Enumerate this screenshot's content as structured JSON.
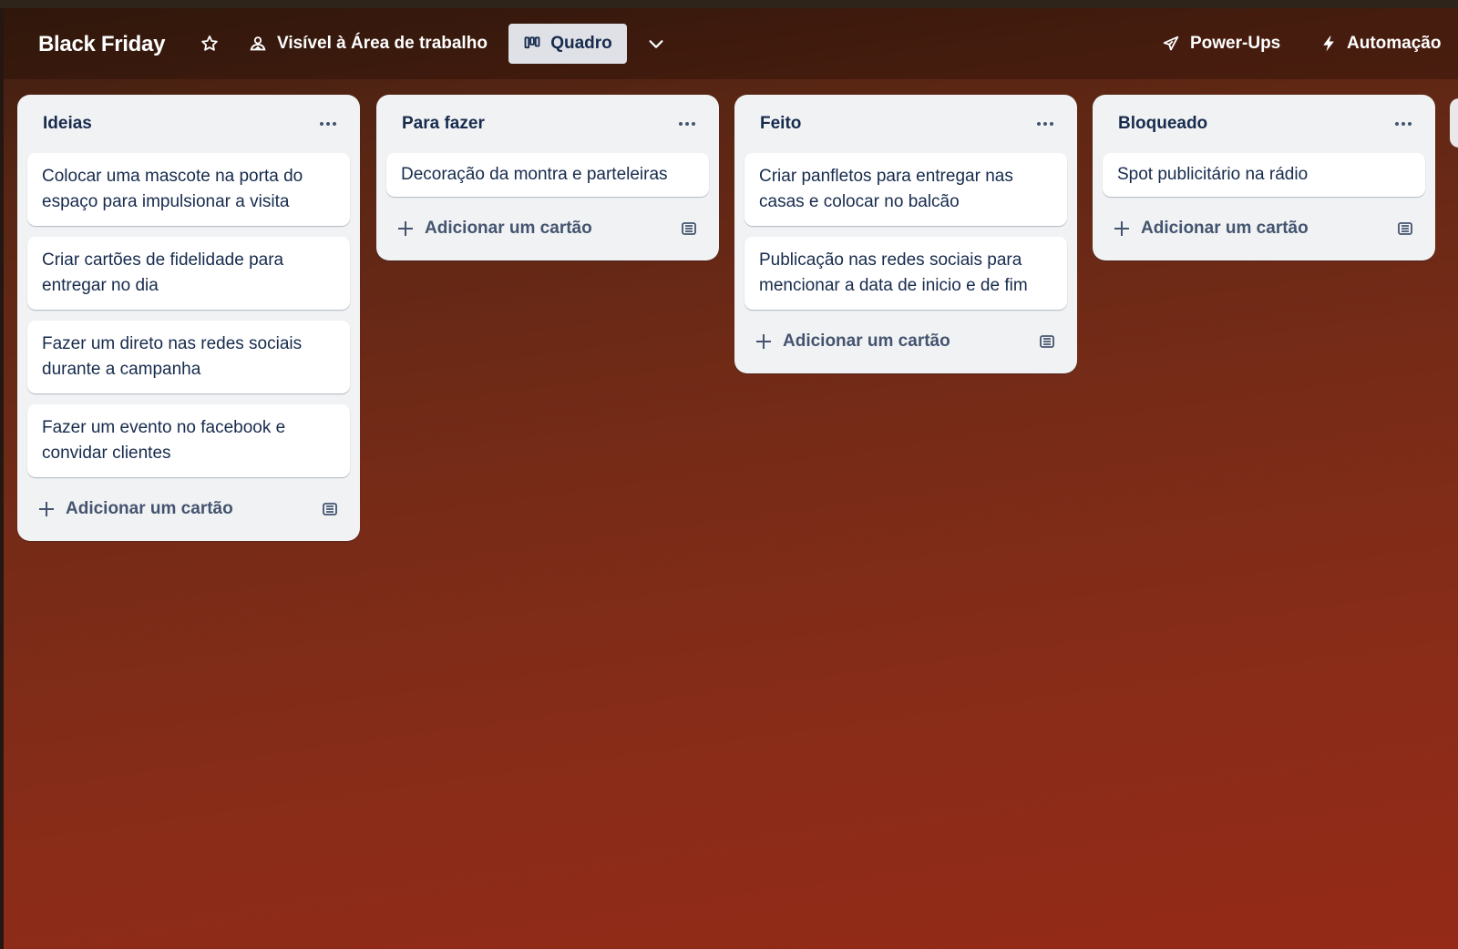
{
  "header": {
    "board_title": "Black Friday",
    "visibility_label": "Visível à Área de trabalho",
    "view_label": "Quadro",
    "powerups_label": "Power-Ups",
    "automation_label": "Automação"
  },
  "lists": [
    {
      "title": "Ideias",
      "cards": [
        "Colocar uma mascote na porta do espaço para impulsionar a visita",
        "Criar cartões de fidelidade para entregar no dia",
        "Fazer um direto nas redes sociais durante a campanha",
        "Fazer um evento no facebook e convidar clientes"
      ],
      "add_label": "Adicionar um cartão"
    },
    {
      "title": "Para fazer",
      "cards": [
        "Decoração da montra e parteleiras"
      ],
      "add_label": "Adicionar um cartão"
    },
    {
      "title": "Feito",
      "cards": [
        "Criar panfletos para entregar nas casas e colocar no balcão",
        "Publicação nas redes sociais para mencionar a data de inicio e de fim"
      ],
      "add_label": "Adicionar um cartão"
    },
    {
      "title": "Bloqueado",
      "cards": [
        "Spot publicitário na rádio"
      ],
      "add_label": "Adicionar um cartão"
    }
  ],
  "icons": {
    "star": "star-icon",
    "visibility": "workspace-people-icon",
    "board": "board-columns-icon",
    "chevron": "chevron-down-icon",
    "powerups": "rocket-icon",
    "automation": "lightning-icon",
    "list_menu": "more-horizontal-icon",
    "add": "plus-icon",
    "template": "card-template-icon"
  },
  "colors": {
    "list_bg": "#f1f2f4",
    "card_bg": "#ffffff",
    "text": "#172b4d",
    "muted_text": "#44546f",
    "view_button_bg": "#dfe1e6"
  }
}
